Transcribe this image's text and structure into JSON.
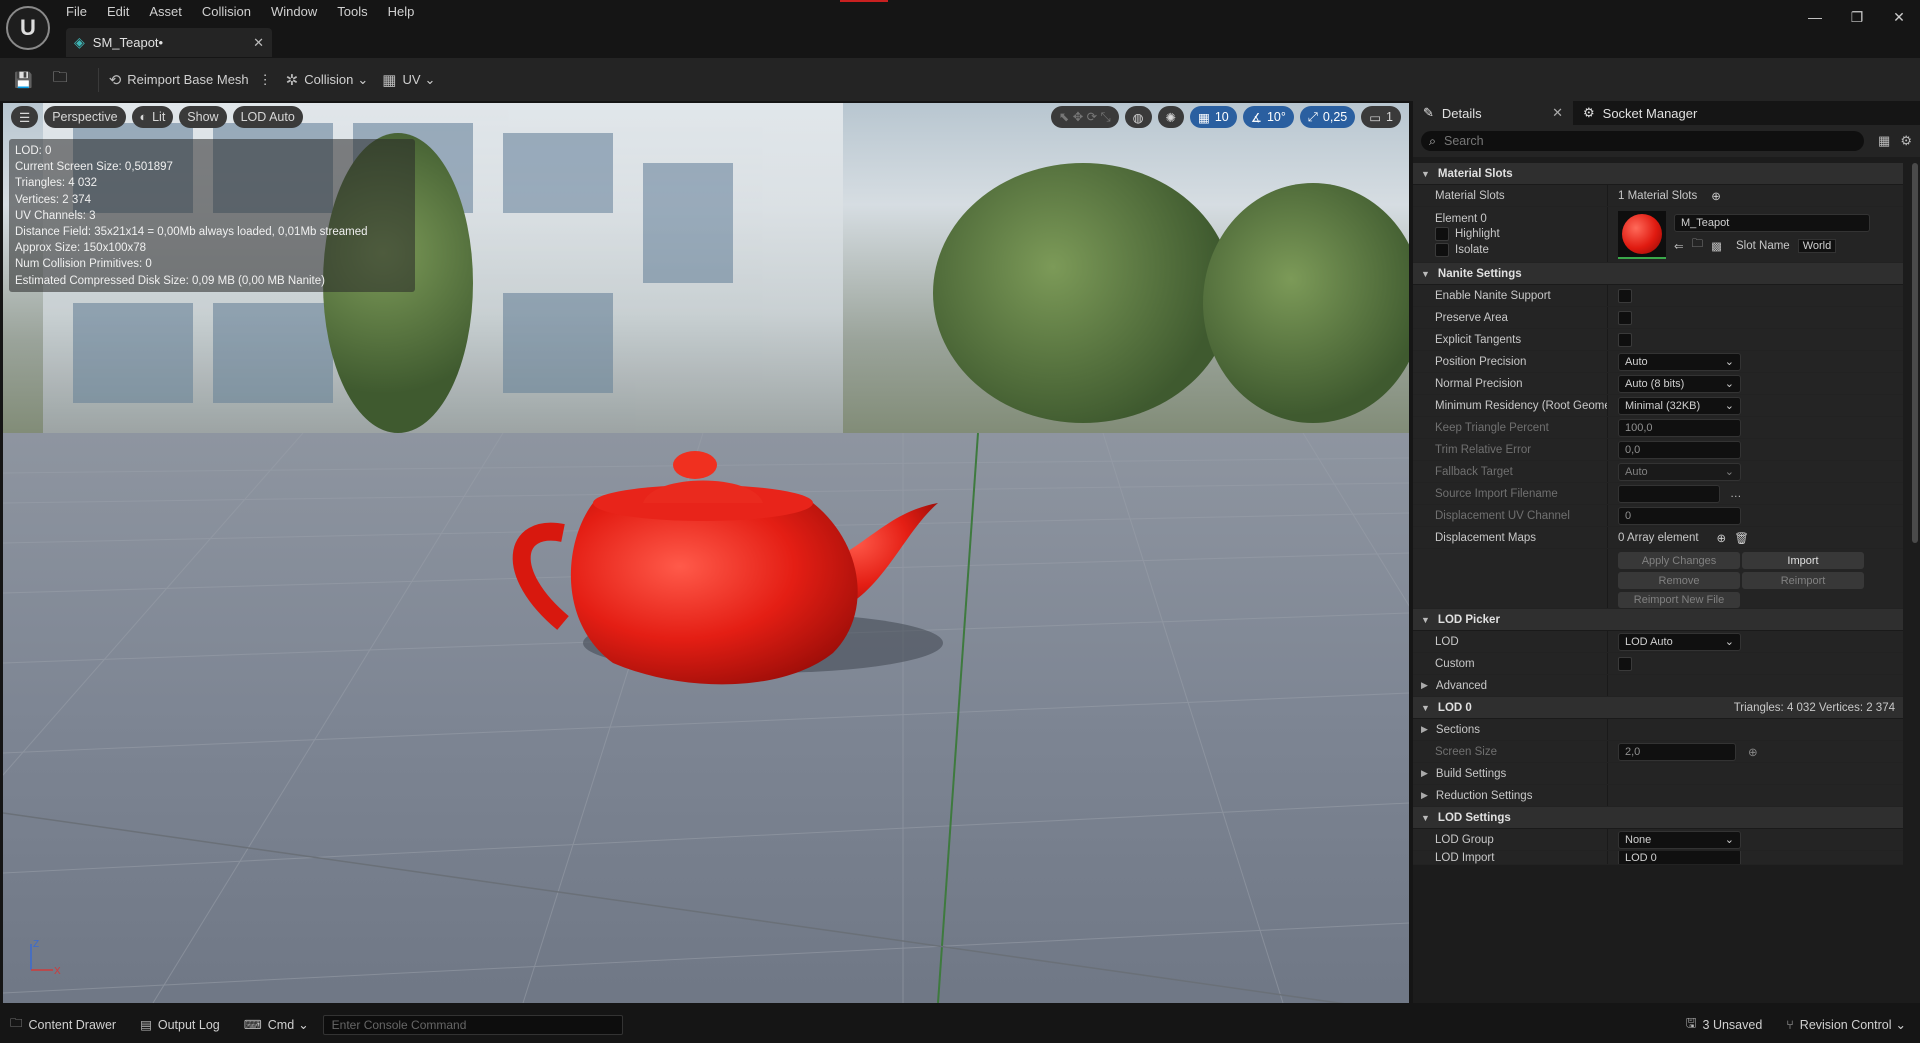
{
  "app": {
    "logo": "unreal-logo"
  },
  "menu": [
    "File",
    "Edit",
    "Asset",
    "Collision",
    "Window",
    "Tools",
    "Help"
  ],
  "tab": {
    "title": "SM_Teapot•"
  },
  "toolbar": {
    "reimport": "Reimport Base Mesh",
    "collision": "Collision",
    "uv": "UV"
  },
  "viewport": {
    "perspective": "Perspective",
    "lit": "Lit",
    "show": "Show",
    "lod": "LOD Auto",
    "grid_snap": "10",
    "rot_snap": "10°",
    "scale_snap": "0,25",
    "cam_speed": "1",
    "hud": [
      "LOD:  0",
      "Current Screen Size:  0,501897",
      "Triangles:  4 032",
      "Vertices:  2 374",
      "UV Channels:  3",
      "Distance Field:  35x21x14 = 0,00Mb always loaded, 0,01Mb streamed",
      "Approx Size: 150x100x78",
      "Num Collision Primitives:  0",
      "Estimated Compressed Disk Size: 0,09 MB (0,00 MB Nanite)"
    ],
    "axis": {
      "z": "Z",
      "x": "X"
    }
  },
  "details": {
    "tab_details": "Details",
    "tab_socket": "Socket Manager",
    "search_placeholder": "Search",
    "material_slots": {
      "header": "Material Slots",
      "label": "Material Slots",
      "value": "1 Material Slots",
      "element": "Element 0",
      "highlight": "Highlight",
      "isolate": "Isolate",
      "material": "M_Teapot",
      "slot_name": "Slot Name",
      "slot_value": "World"
    },
    "nanite": {
      "header": "Nanite Settings",
      "enable": "Enable Nanite Support",
      "preserve": "Preserve Area",
      "tangents": "Explicit Tangents",
      "pos_prec": "Position Precision",
      "pos_val": "Auto",
      "norm_prec": "Normal Precision",
      "norm_val": "Auto (8 bits)",
      "min_res": "Minimum Residency (Root Geome",
      "min_val": "Minimal (32KB)",
      "keep_tri": "Keep Triangle Percent",
      "keep_val": "100,0",
      "trim": "Trim Relative Error",
      "trim_val": "0,0",
      "fallback": "Fallback Target",
      "fallback_val": "Auto",
      "source": "Source Import Filename",
      "disp_uv": "Displacement UV Channel",
      "disp_uv_val": "0",
      "disp_maps": "Displacement Maps",
      "disp_maps_val": "0 Array element",
      "apply": "Apply Changes",
      "import": "Import",
      "remove": "Remove",
      "reimport": "Reimport",
      "reimport_new": "Reimport New File"
    },
    "lod_picker": {
      "header": "LOD Picker",
      "lod": "LOD",
      "lod_val": "LOD Auto",
      "custom": "Custom",
      "advanced": "Advanced"
    },
    "lod0": {
      "header": "LOD 0",
      "stats": "Triangles: 4 032    Vertices: 2 374",
      "sections": "Sections",
      "screen_size": "Screen Size",
      "screen_val": "2,0",
      "build": "Build Settings",
      "reduction": "Reduction Settings"
    },
    "lod_settings": {
      "header": "LOD Settings",
      "group": "LOD Group",
      "group_val": "None",
      "import": "LOD Import",
      "import_val": "LOD 0"
    }
  },
  "statusbar": {
    "content": "Content Drawer",
    "output": "Output Log",
    "cmd": "Cmd",
    "console_placeholder": "Enter Console Command",
    "unsaved": "3 Unsaved",
    "revision": "Revision Control"
  }
}
